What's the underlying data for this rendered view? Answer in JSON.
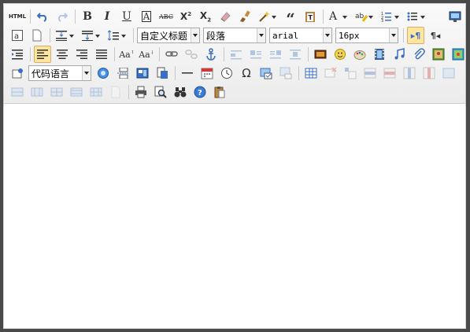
{
  "toolbar": {
    "html_label": "HTML",
    "custom_title_value": "自定义标题",
    "paragraph_value": "段落",
    "font_family_value": "arial",
    "font_size_value": "16px",
    "code_language_value": "代码语言"
  },
  "icons": [
    "source-html",
    "undo",
    "redo",
    "bold",
    "italic",
    "underline",
    "font-border",
    "strikethrough",
    "superscript",
    "subscript",
    "eraser",
    "format-brush",
    "autotype",
    "blockquote",
    "paste-plain",
    "font-color",
    "highlight",
    "ordered-list",
    "unordered-list",
    "fullscreen",
    "select-all",
    "clear-doc",
    "row-spacing-top",
    "row-spacing-bottom",
    "line-height",
    "ltr",
    "rtl",
    "indent",
    "align-left",
    "align-center",
    "align-right",
    "align-justify",
    "uppercase",
    "lowercase",
    "link",
    "unlink",
    "anchor",
    "image-none",
    "image-left",
    "image-right",
    "image-center",
    "insert-image",
    "emotion",
    "scrawl",
    "video",
    "music",
    "attachment",
    "map",
    "gmap",
    "frame",
    "code",
    "page-break",
    "template",
    "horizontal-rule",
    "date",
    "time",
    "special-chars",
    "wordimage",
    "background",
    "table",
    "insert-row",
    "insert-col",
    "merge-right",
    "merge-down",
    "split-cells",
    "insert-para",
    "delete-table",
    "print",
    "preview",
    "search-replace",
    "help",
    "drafts"
  ],
  "colors": {
    "active_bg": "#ffe69f",
    "active_border": "#dcac6c",
    "frame": "#4a4a4a"
  }
}
